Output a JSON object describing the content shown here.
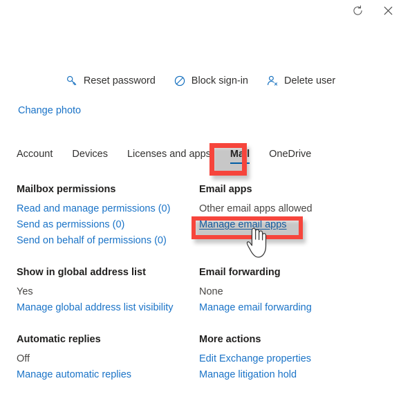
{
  "colors": {
    "link": "#1a73c7",
    "accent": "#0078d4",
    "annotation_red": "#f6453c",
    "text": "#323130",
    "heading": "#201f1e",
    "icon_blue": "#0f6cbd"
  },
  "window_controls": [
    {
      "name": "refresh-icon",
      "label": "Refresh"
    },
    {
      "name": "close-icon",
      "label": "Close"
    }
  ],
  "command_bar": {
    "actions": [
      {
        "icon": "key-icon",
        "label": "Reset password"
      },
      {
        "icon": "block-icon",
        "label": "Block sign-in"
      },
      {
        "icon": "delete-user-icon",
        "label": "Delete user"
      }
    ]
  },
  "change_photo": {
    "label": "Change photo"
  },
  "tabs": {
    "selected": "Mail",
    "items": [
      {
        "label": "Account"
      },
      {
        "label": "Devices"
      },
      {
        "label": "Licenses and apps"
      },
      {
        "label": "Mail"
      },
      {
        "label": "OneDrive"
      }
    ]
  },
  "sections": {
    "mailbox_permissions": {
      "title": "Mailbox permissions",
      "links": [
        "Read and manage permissions (0)",
        "Send as permissions (0)",
        "Send on behalf of permissions (0)"
      ]
    },
    "email_apps": {
      "title": "Email apps",
      "value": "Other email apps allowed",
      "link": "Manage email apps"
    },
    "global_address_list": {
      "title": "Show in global address list",
      "value": "Yes",
      "link": "Manage global address list visibility"
    },
    "email_forwarding": {
      "title": "Email forwarding",
      "value": "None",
      "link": "Manage email forwarding"
    },
    "automatic_replies": {
      "title": "Automatic replies",
      "value": "Off",
      "link": "Manage automatic replies"
    },
    "more_actions": {
      "title": "More actions",
      "links": [
        "Edit Exchange properties",
        "Manage litigation hold"
      ]
    }
  },
  "annotations": [
    {
      "name": "mail-tab-highlight",
      "target": "Mail"
    },
    {
      "name": "manage-email-apps-highlight",
      "target": "Manage email apps"
    }
  ],
  "cursor": {
    "type": "hand-pointer"
  }
}
